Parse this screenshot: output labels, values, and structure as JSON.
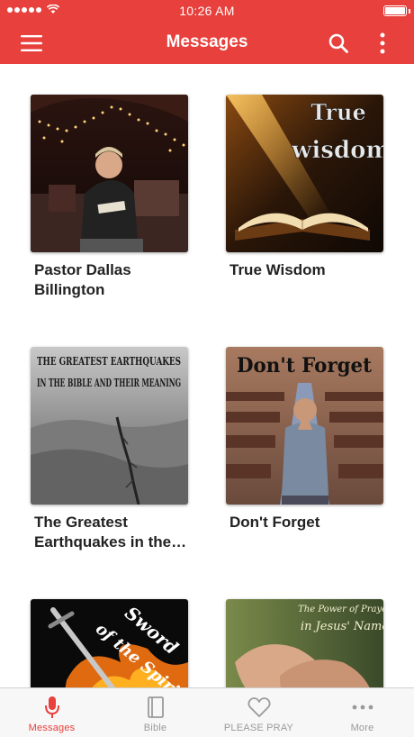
{
  "status_bar": {
    "time": "10:26 AM"
  },
  "header": {
    "title": "Messages"
  },
  "messages": [
    {
      "title": "Pastor Dallas Billington"
    },
    {
      "title": "True Wisdom",
      "image_text_1": "True",
      "image_text_2": "wisdom"
    },
    {
      "title": "The Greatest Earthquakes in the Bible and Their Meaning",
      "image_text_1": "THE GREATEST EARTHQUAKES",
      "image_text_2": "IN THE BIBLE AND THEIR MEANING"
    },
    {
      "title": "Don't Forget",
      "image_text": "Don't Forget"
    },
    {
      "title": "",
      "image_text_1": "Sword",
      "image_text_2": "of the Spirit"
    },
    {
      "title": "",
      "image_text_1": "The Power of Prayer",
      "image_text_2": "in Jesus' Name"
    }
  ],
  "tab_bar": {
    "tabs": [
      {
        "label": "Messages",
        "icon": "microphone-icon",
        "active": true
      },
      {
        "label": "Bible",
        "icon": "book-icon",
        "active": false
      },
      {
        "label": "PLEASE PRAY",
        "icon": "heart-icon",
        "active": false
      },
      {
        "label": "More",
        "icon": "ellipsis-icon",
        "active": false
      }
    ]
  },
  "colors": {
    "brand": "#e8403c",
    "tab_inactive": "#9a9a9a",
    "text": "#222222"
  }
}
